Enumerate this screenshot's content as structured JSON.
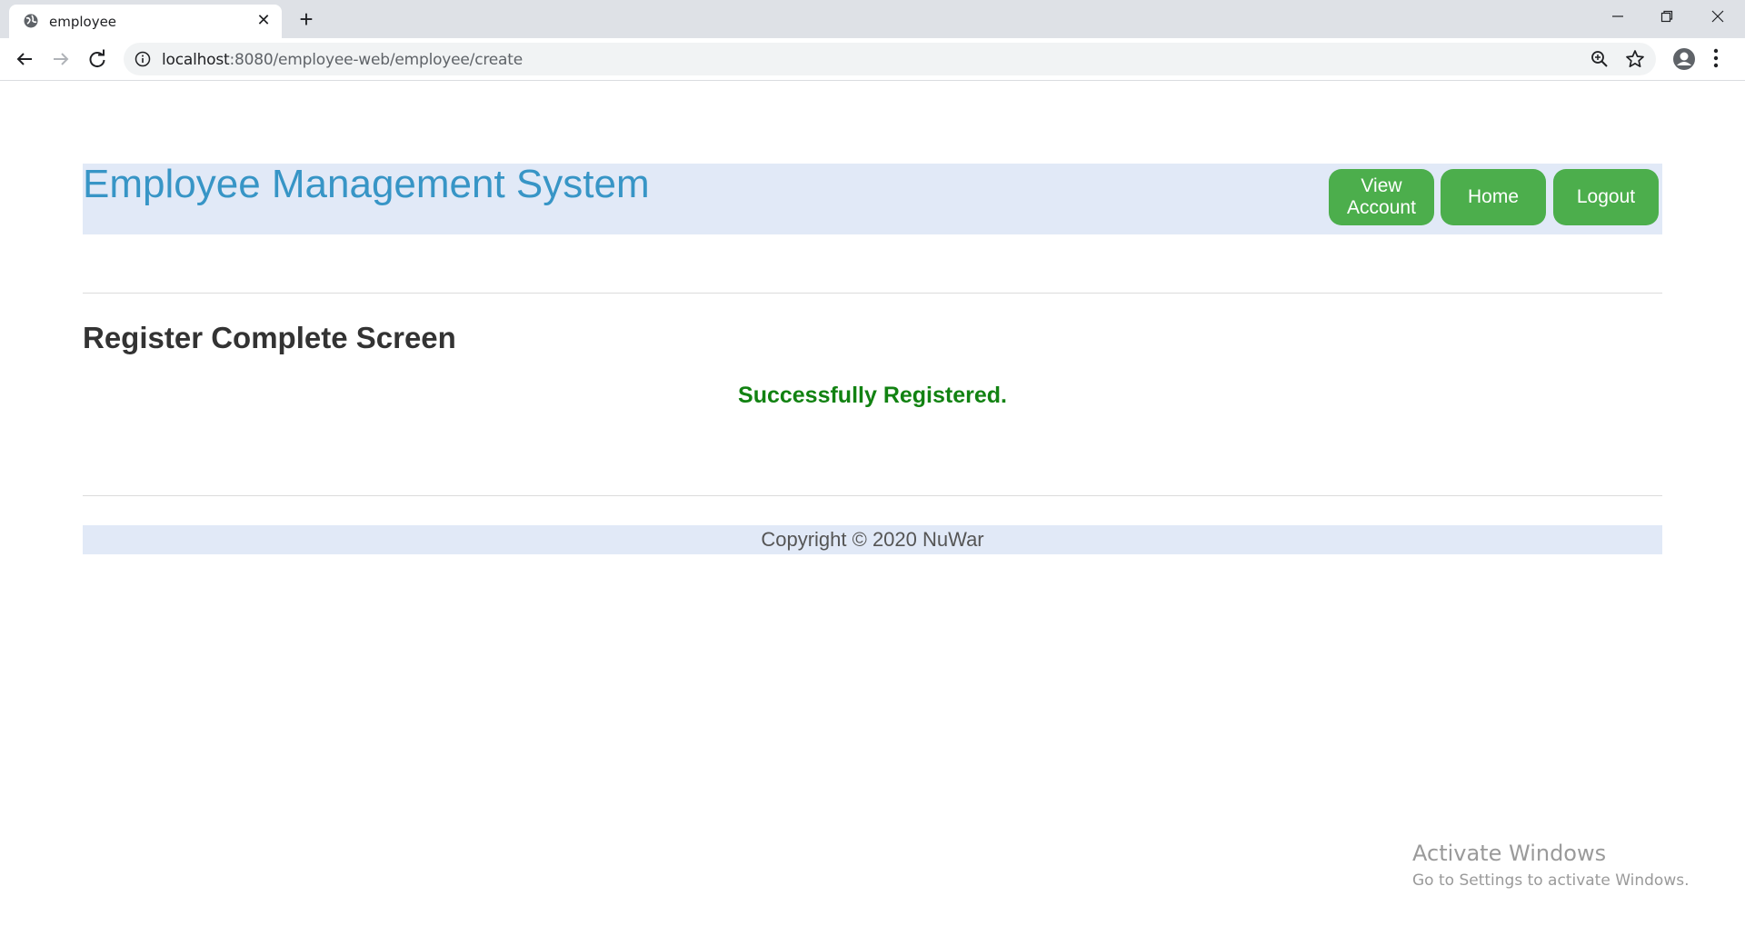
{
  "browser": {
    "tab_title": "employee",
    "url_host": "localhost",
    "url_rest": ":8080/employee-web/employee/create"
  },
  "header": {
    "site_title": "Employee Management System",
    "nav": {
      "view_account": "View Account",
      "home": "Home",
      "logout": "Logout"
    }
  },
  "main": {
    "section_title": "Register Complete Screen",
    "success_message": "Successfully Registered."
  },
  "footer": {
    "copyright": "Copyright © 2020 NuWar"
  },
  "watermark": {
    "line1": "Activate Windows",
    "line2": "Go to Settings to activate Windows."
  },
  "colors": {
    "header_bg": "#e1e9f7",
    "title": "#3795c6",
    "button": "#4cae4c",
    "success": "#128212"
  }
}
